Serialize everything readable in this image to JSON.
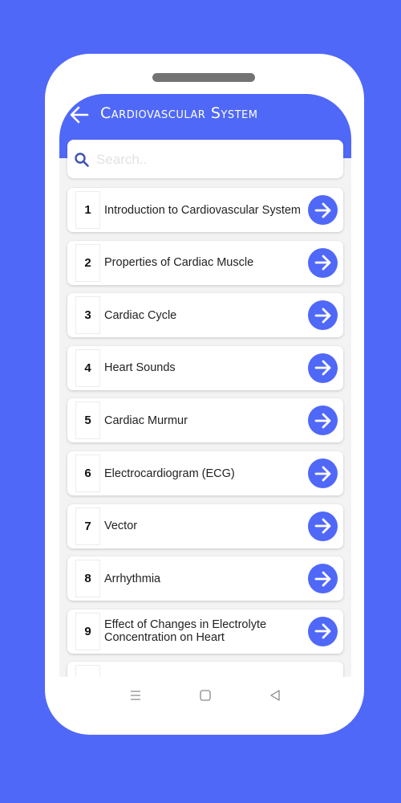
{
  "app": {
    "title": "Cardiovascular System",
    "accent_color": "#5068f8"
  },
  "search": {
    "placeholder": "Search..",
    "value": ""
  },
  "topics": [
    {
      "number": "1",
      "label": "Introduction to Cardiovascular System"
    },
    {
      "number": "2",
      "label": "Properties of Cardiac Muscle"
    },
    {
      "number": "3",
      "label": "Cardiac Cycle"
    },
    {
      "number": "4",
      "label": "Heart Sounds"
    },
    {
      "number": "5",
      "label": "Cardiac Murmur"
    },
    {
      "number": "6",
      "label": "Electrocardiogram (ECG)"
    },
    {
      "number": "7",
      "label": "Vector"
    },
    {
      "number": "8",
      "label": "Arrhythmia"
    },
    {
      "number": "9",
      "label": "Effect of Changes in Electrolyte Concentration on Heart"
    }
  ],
  "icons": {
    "back": "arrow-left-icon",
    "search": "search-icon",
    "go": "arrow-right-icon",
    "nav_menu": "menu-icon",
    "nav_home": "home-square-icon",
    "nav_back": "back-triangle-icon"
  }
}
